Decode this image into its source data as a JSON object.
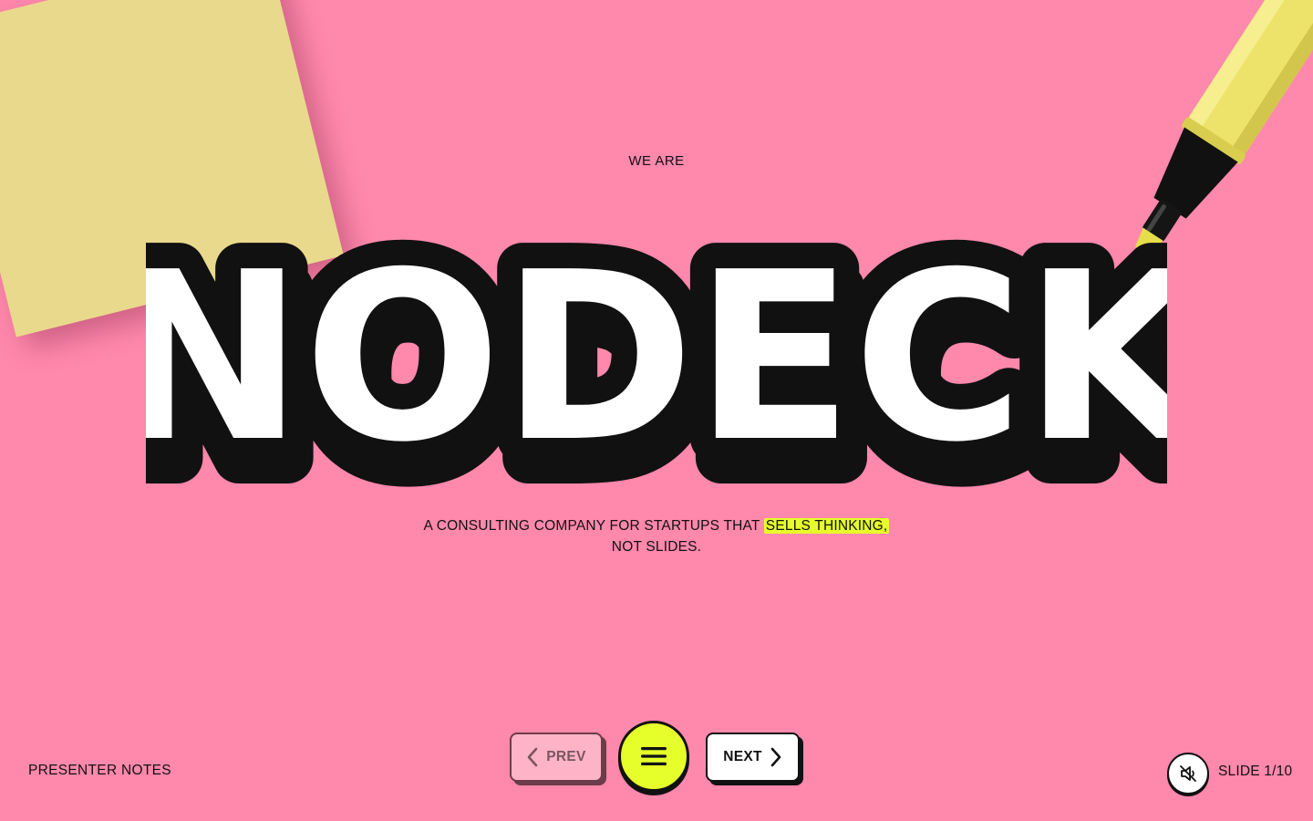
{
  "hero": {
    "eyebrow": "WE ARE",
    "wordmark": "NODECK",
    "tagline_before": "A CONSULTING COMPANY FOR STARTUPS THAT ",
    "tagline_highlight": "SELLS THINKING,",
    "tagline_after": "NOT SLIDES."
  },
  "controls": {
    "presenter_notes": "PRESENTER NOTES",
    "prev_label": "PREV",
    "next_label": "NEXT",
    "menu_icon": "hamburger-menu-icon",
    "mute_icon": "sound-muted-icon",
    "slide_counter": "SLIDE 1/10"
  },
  "colors": {
    "background": "#ff88ad",
    "accent": "#e6ff2a",
    "sticky_note": "#e9d98c",
    "highlighter": "#eee36a"
  }
}
